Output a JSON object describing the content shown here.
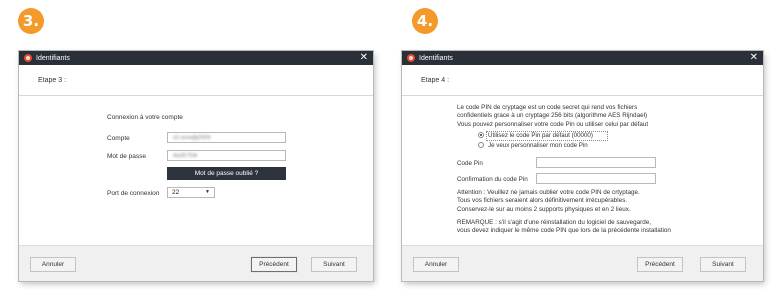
{
  "badges": {
    "step3": "3.",
    "step4": "4."
  },
  "colors": {
    "badge": "#f39a2a",
    "titlebar": "#2a2f38",
    "app_icon": "#e9492a",
    "dark_button": "#2d333d"
  },
  "window3": {
    "title": "Identifiants",
    "step_title": "Etape 3 :",
    "section_title": "Connexion à votre compte",
    "account_label": "Compte",
    "account_value": "s2-sora@j2004",
    "password_label": "Mot de passe",
    "password_value": "Aa2E7DA",
    "forgot_button": "Mot de passe oublié ?",
    "port_label": "Port de connexion",
    "port_value": "22",
    "cancel": "Annuler",
    "previous": "Précédent",
    "next": "Suivant"
  },
  "window4": {
    "title": "Identifiants",
    "step_title": "Etape 4 :",
    "intro_line1": "Le code PIN de cryptage est un code secret qui rend vos fichiers",
    "intro_line2": "confidentiels grace à un cryptage 256 bits (algorithme AES Rijndael)",
    "intro_line3": "Vous pouvez personnaliser votre code Pin ou utiliser celui par défaut",
    "radio_default": "Utilisez le code Pin par défaut (00000)",
    "radio_custom": "Je veux personnaliser mon code Pin",
    "pin_label": "Code Pin",
    "pin_confirm_label": "Confirmation du code Pin",
    "attention1": "Attention : Veuillez ne jamais oublier votre code PIN de crtyptage.",
    "attention2": "Tous vos fichiers seraient alors définitivement irrécupérables.",
    "attention3": "Conservez-le sur au moins 2 supports physiques et en 2 lieux.",
    "remark1": "REMARQUE : s'il s'agit d'une réinstallation du logiciel de sauvegarde,",
    "remark2": "vous devez indiquer le même code PIN que lors de la précédente installation",
    "cancel": "Annuler",
    "previous": "Précédent",
    "next": "Suivant"
  },
  "icons": {
    "app": "app-logo-icon",
    "close": "close-icon",
    "dropdown": "chevron-down-icon"
  }
}
